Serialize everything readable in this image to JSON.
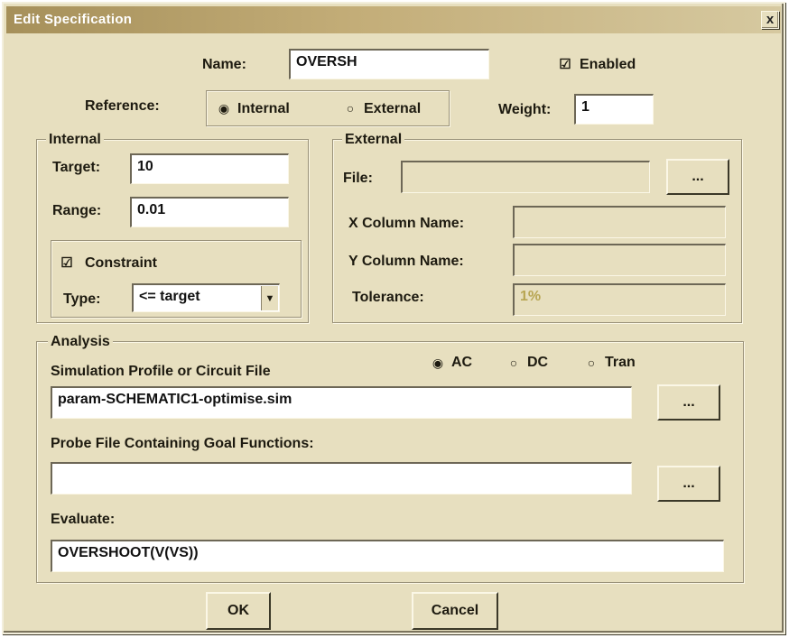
{
  "window": {
    "title": "Edit Specification",
    "close_glyph": "x"
  },
  "name": {
    "label": "Name:",
    "value": "OVERSH"
  },
  "enabled": {
    "label": "Enabled",
    "checked": true
  },
  "reference": {
    "label": "Reference:",
    "internal_label": "Internal",
    "external_label": "External",
    "selected": "Internal"
  },
  "weight": {
    "label": "Weight:",
    "value": "1"
  },
  "internal": {
    "title": "Internal",
    "target_label": "Target:",
    "target_value": "10",
    "range_label": "Range:",
    "range_value": "0.01",
    "constraint_label": "Constraint",
    "constraint_checked": true,
    "type_label": "Type:",
    "type_value": "<= target"
  },
  "external": {
    "title": "External",
    "file_label": "File:",
    "file_value": "",
    "browse_label": "...",
    "xcol_label": "X Column Name:",
    "xcol_value": "",
    "ycol_label": "Y Column Name:",
    "ycol_value": "",
    "tolerance_label": "Tolerance:",
    "tolerance_value": "1%"
  },
  "analysis": {
    "title": "Analysis",
    "sim_label": "Simulation Profile or Circuit File",
    "sim_value": "param-SCHEMATIC1-optimise.sim",
    "sim_browse": "...",
    "modes": [
      "AC",
      "DC",
      "Tran"
    ],
    "selected_mode": "AC",
    "probe_label": "Probe File Containing Goal Functions:",
    "probe_value": "",
    "probe_browse": "...",
    "evaluate_label": "Evaluate:",
    "evaluate_value": "OVERSHOOT(V(VS))"
  },
  "buttons": {
    "ok": "OK",
    "cancel": "Cancel"
  },
  "icons": {
    "checkbox_checked": "☑",
    "radio_selected": "◉",
    "radio_empty": "○"
  }
}
